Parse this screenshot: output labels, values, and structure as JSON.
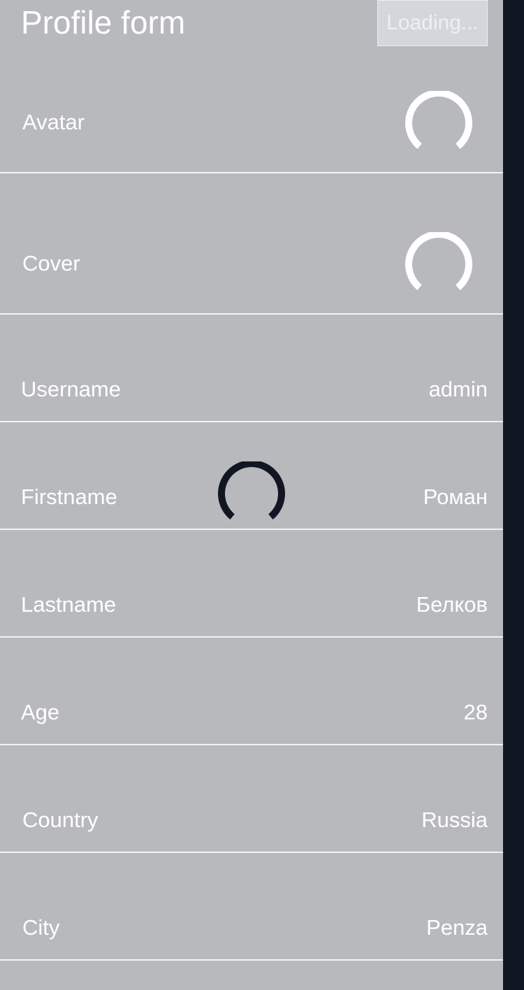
{
  "header": {
    "title": "Profile form",
    "loading_label": "Loading..."
  },
  "fields": {
    "avatar": {
      "label": "Avatar"
    },
    "cover": {
      "label": "Cover"
    },
    "username": {
      "label": "Username",
      "value": "admin"
    },
    "firstname": {
      "label": "Firstname",
      "value": "Роман"
    },
    "lastname": {
      "label": "Lastname",
      "value": "Белков"
    },
    "age": {
      "label": "Age",
      "value": "28"
    },
    "country": {
      "label": "Country",
      "value": "Russia"
    },
    "city": {
      "label": "City",
      "value": "Penza"
    }
  },
  "colors": {
    "background": "#b8b9bc",
    "scrollbar": "#111623",
    "spinner_light": "#ffffff",
    "spinner_dark": "#111623"
  }
}
